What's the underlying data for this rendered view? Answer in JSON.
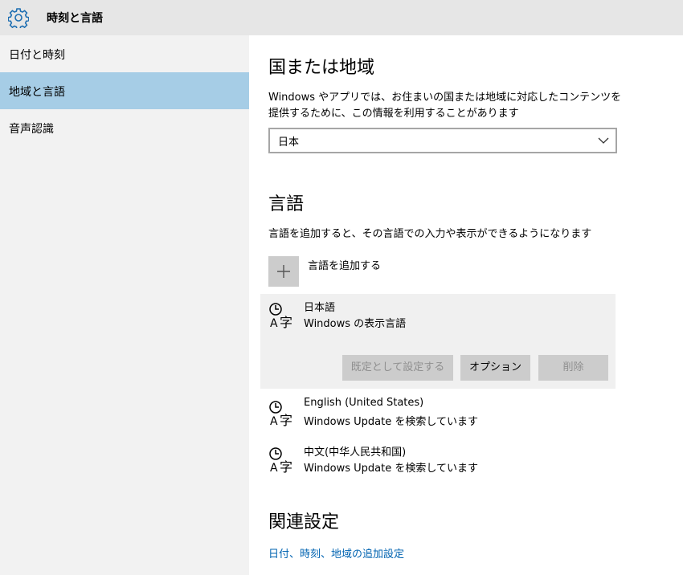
{
  "window": {
    "title": "時刻と言語",
    "icon": "gear-icon"
  },
  "sidebar": {
    "items": [
      {
        "label": "日付と時刻",
        "selected": false
      },
      {
        "label": "地域と言語",
        "selected": true
      },
      {
        "label": "音声認識",
        "selected": false
      }
    ]
  },
  "region": {
    "heading": "国または地域",
    "description": "Windows やアプリでは、お住まいの国または地域に対応したコンテンツを提供するために、この情報を利用することがあります",
    "selected_country": "日本"
  },
  "language": {
    "heading": "言語",
    "description": "言語を追加すると、その言語での入力や表示ができるようになります",
    "add_label": "言語を追加する",
    "items": [
      {
        "name": "日本語",
        "status": "Windows の表示言語",
        "buttons": {
          "set_default": "既定として設定する",
          "options": "オプション",
          "remove": "削除"
        }
      },
      {
        "name": "English (United States)",
        "status": "Windows Update を検索しています"
      },
      {
        "name": "中文(中华人民共和国)",
        "status": "Windows Update を検索しています"
      }
    ]
  },
  "related": {
    "heading": "関連設定",
    "link": "日付、時刻、地域の追加設定"
  },
  "colors": {
    "titlebar": "#e6e6e6",
    "sidebar": "#f2f2f2",
    "selected_nav": "#a6cde6",
    "link": "#0063b1",
    "button": "#cccccc"
  }
}
